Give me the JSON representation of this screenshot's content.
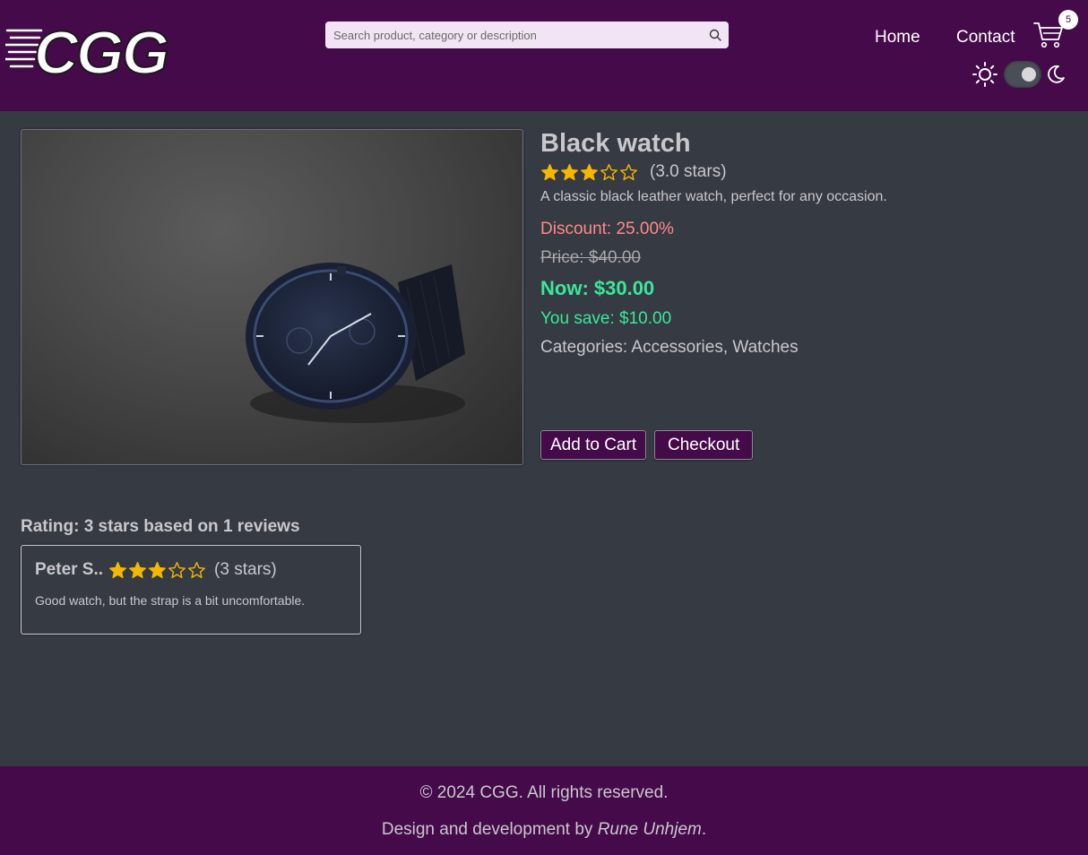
{
  "header": {
    "logo_text": "CGG",
    "search": {
      "placeholder": "Search product, category or description",
      "value": ""
    },
    "nav": {
      "home": "Home",
      "contact": "Contact"
    },
    "cart_count": "5",
    "theme_mode": "dark"
  },
  "product": {
    "title": "Black watch",
    "rating": 3,
    "rating_max": 5,
    "rating_text": "(3.0 stars)",
    "description": "A classic black leather watch, perfect for any occasion.",
    "discount": "Discount: 25.00%",
    "price": "Price: $40.00",
    "now": "Now: $30.00",
    "save": "You save: $10.00",
    "categories": "Categories: Accessories, Watches",
    "add_to_cart": "Add to Cart",
    "checkout": "Checkout"
  },
  "reviews": {
    "summary": "Rating: 3 stars based on 1 reviews",
    "items": [
      {
        "name": "Peter S..",
        "rating": 3,
        "rating_text": "(3 stars)",
        "text": "Good watch, but the strap is a bit uncomfortable."
      }
    ]
  },
  "footer": {
    "copyright": "© 2024 CGG. All rights reserved.",
    "credit_prefix": "Design and development by ",
    "credit_name": "Rune Unhjem",
    "credit_suffix": "."
  },
  "colors": {
    "header_bg": "#450a4a",
    "page_bg": "#363a42",
    "star": "#f5b800",
    "discount": "#ff8a8a",
    "price_now": "#39e89a"
  }
}
